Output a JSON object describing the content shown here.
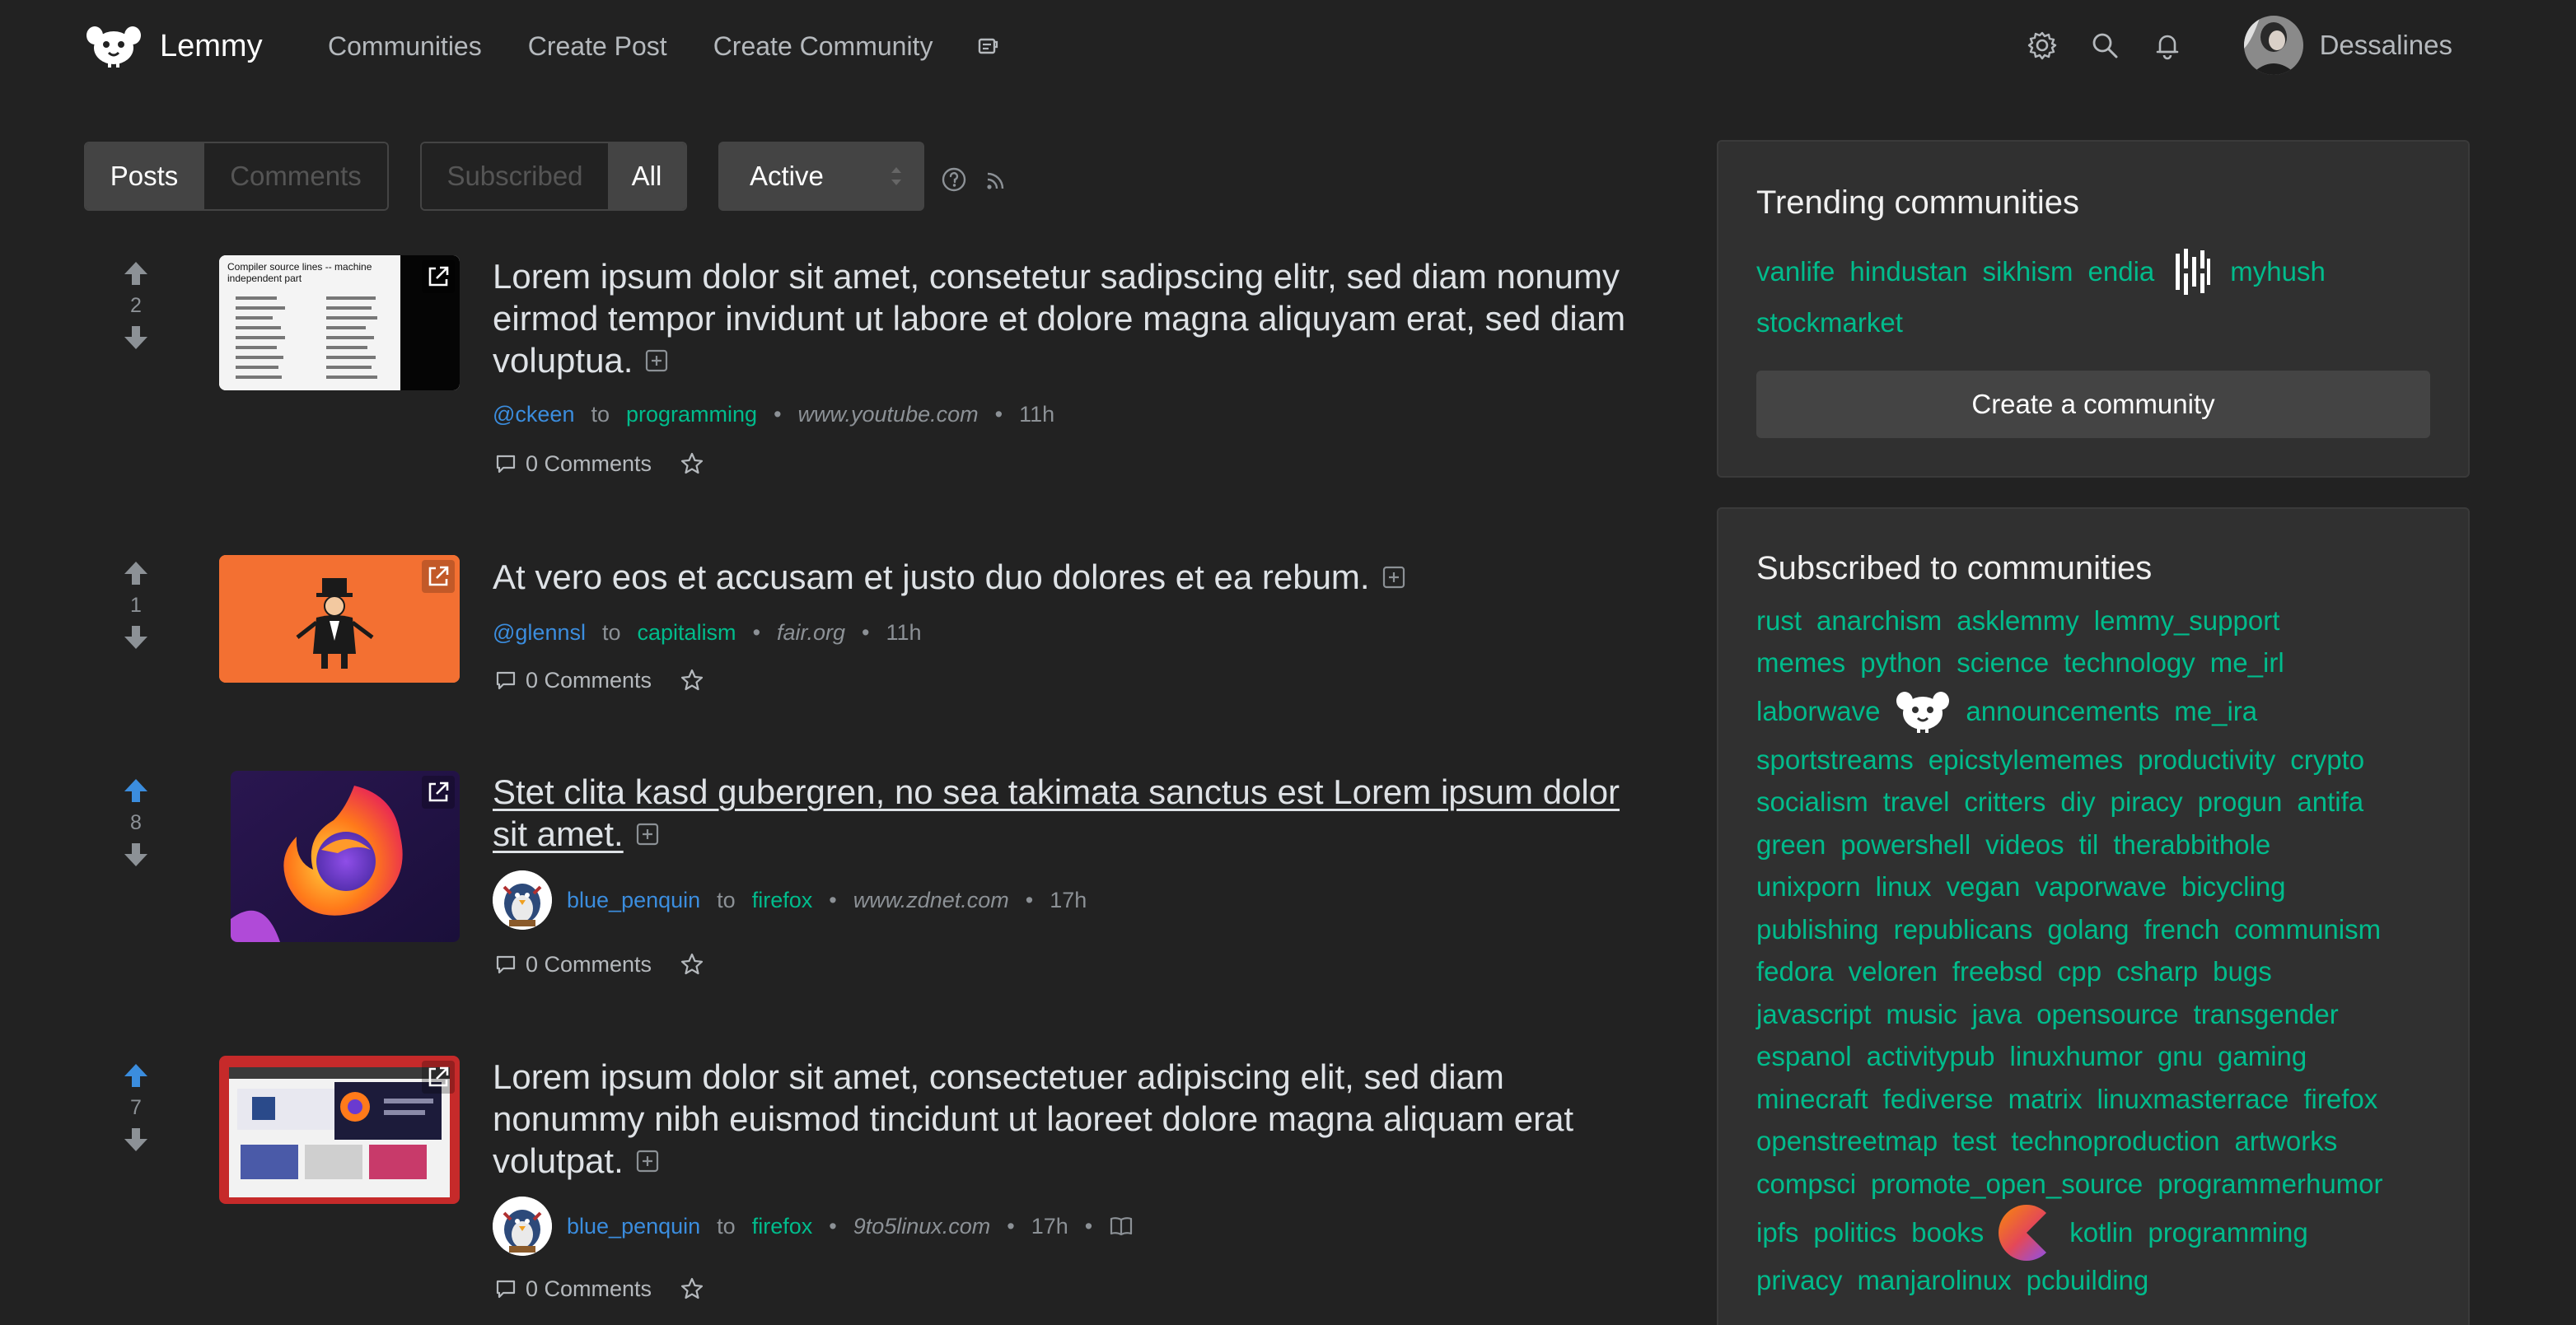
{
  "nav": {
    "brand": "Lemmy",
    "links": [
      "Communities",
      "Create Post",
      "Create Community"
    ],
    "icons": [
      "legal-doc-icon",
      "settings-icon",
      "search-icon",
      "notifications-icon"
    ],
    "username": "Dessalines"
  },
  "toolbar": {
    "listing_type": {
      "posts": "Posts",
      "comments": "Comments",
      "selected": "Posts"
    },
    "scope": {
      "subscribed": "Subscribed",
      "all": "All",
      "selected": "All"
    },
    "sort": {
      "value": "Active"
    }
  },
  "posts": [
    {
      "score": "2",
      "title": "Lorem ipsum dolor sit amet, consetetur sadipscing elitr, sed diam nonumy eirmod tempor invidunt ut labore et dolore magna aliquyam erat, sed diam voluptua.",
      "author": "@ckeen",
      "to": "to",
      "community": "programming",
      "domain": "www.youtube.com",
      "time": "11h",
      "comments": "0 Comments",
      "thumb_text": [
        "Compiler source lines -- machine",
        "independent part"
      ]
    },
    {
      "score": "1",
      "title": "At vero eos et accusam et justo duo dolores et ea rebum.",
      "author": "@glennsl",
      "to": "to",
      "community": "capitalism",
      "domain": "fair.org",
      "time": "11h",
      "comments": "0 Comments"
    },
    {
      "score": "8",
      "title": "Stet clita kasd gubergren, no sea takimata sanctus est Lorem ipsum dolor sit amet.",
      "author": "blue_penquin",
      "to": "to",
      "community": "firefox",
      "domain": "www.zdnet.com",
      "time": "17h",
      "comments": "0 Comments",
      "upvoted": true
    },
    {
      "score": "7",
      "title": "Lorem ipsum dolor sit amet, consectetuer adipiscing elit, sed diam nonummy nibh euismod tincidunt ut laoreet dolore magna aliquam erat volutpat.",
      "author": "blue_penquin",
      "to": "to",
      "community": "firefox",
      "domain": "9to5linux.com",
      "time": "17h",
      "comments": "0 Comments",
      "upvoted": true
    }
  ],
  "sidebar": {
    "trending": {
      "title": "Trending communities",
      "row1": [
        "vanlife",
        "hindustan",
        "sikhism",
        "endia"
      ],
      "row1_after_icon": "myhush",
      "row2": [
        "stockmarket"
      ],
      "create_button": "Create a community"
    },
    "subscribed": {
      "title": "Subscribed to communities",
      "rows": [
        [
          "rust",
          "anarchism",
          "asklemmy",
          "lemmy_support"
        ],
        [
          "memes",
          "python",
          "science",
          "technology",
          "me_irl"
        ],
        [
          "laborwave",
          "@icon:lemmy",
          "announcements",
          "me_ira"
        ],
        [
          "sportstreams",
          "epicstylememes",
          "productivity",
          "crypto"
        ],
        [
          "socialism",
          "travel",
          "critters",
          "diy",
          "piracy",
          "progun",
          "antifa"
        ],
        [
          "green",
          "powershell",
          "videos",
          "til",
          "therabbithole"
        ],
        [
          "unixporn",
          "linux",
          "vegan",
          "vaporwave",
          "bicycling"
        ],
        [
          "publishing",
          "republicans",
          "golang",
          "french",
          "communism"
        ],
        [
          "fedora",
          "veloren",
          "freebsd",
          "cpp",
          "csharp",
          "bugs"
        ],
        [
          "javascript",
          "music",
          "java",
          "opensource",
          "transgender"
        ],
        [
          "espanol",
          "activitypub",
          "linuxhumor",
          "gnu",
          "gaming"
        ],
        [
          "minecraft",
          "fediverse",
          "matrix",
          "linuxmasterrace",
          "firefox"
        ],
        [
          "openstreetmap",
          "test",
          "technoproduction",
          "artworks"
        ],
        [
          "compsci",
          "promote_open_source",
          "programmerhumor"
        ],
        [
          "ipfs",
          "politics",
          "books",
          "@icon:kotlin",
          "kotlin",
          "programming"
        ],
        [
          "privacy",
          "manjarolinux",
          "pcbuilding"
        ]
      ]
    }
  }
}
